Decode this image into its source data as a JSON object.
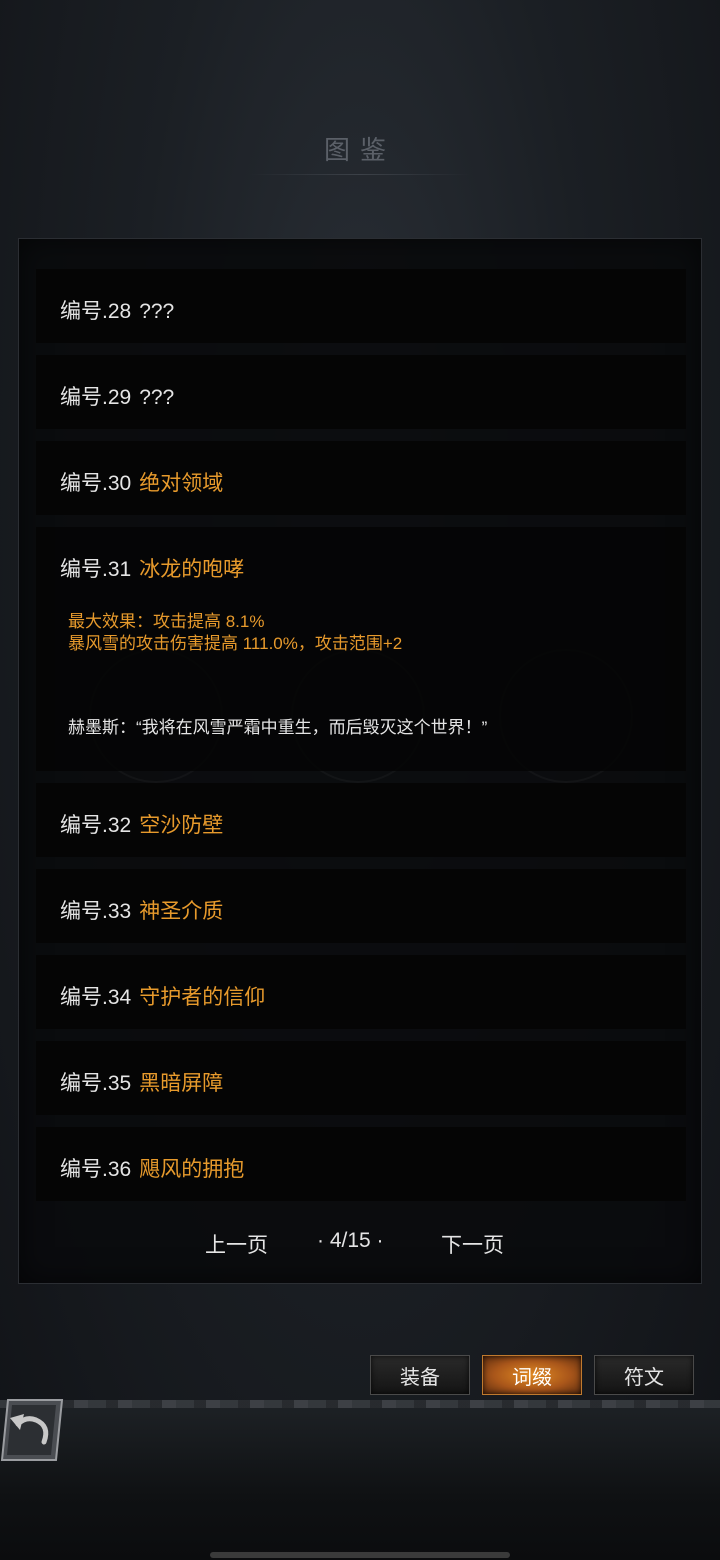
{
  "header": {
    "title": "图鉴"
  },
  "entries": [
    {
      "number": "编号.28",
      "name": "???"
    },
    {
      "number": "编号.29",
      "name": "???"
    },
    {
      "number": "编号.30",
      "name": "绝对领域"
    },
    {
      "number": "编号.31",
      "name": "冰龙的咆哮",
      "effect_line1": "最大效果：攻击提高 8.1%",
      "effect_line2": "暴风雪的攻击伤害提高 111.0%，攻击范围+2",
      "quote": "赫墨斯：“我将在风雪严霜中重生，而后毁灭这个世界！”"
    },
    {
      "number": "编号.32",
      "name": "空沙防壁"
    },
    {
      "number": "编号.33",
      "name": "神圣介质"
    },
    {
      "number": "编号.34",
      "name": "守护者的信仰"
    },
    {
      "number": "编号.35",
      "name": "黑暗屏障"
    },
    {
      "number": "编号.36",
      "name": "飓风的拥抱"
    }
  ],
  "pager": {
    "prev_label": "上一页",
    "page_indicator": "· 4/15 ·",
    "next_label": "下一页"
  },
  "tabs": {
    "equipment": "装备",
    "affix": "词缀",
    "rune": "符文",
    "active": "affix"
  },
  "colors": {
    "accent": "#e79a2c",
    "active_tab": "#d47e22"
  }
}
